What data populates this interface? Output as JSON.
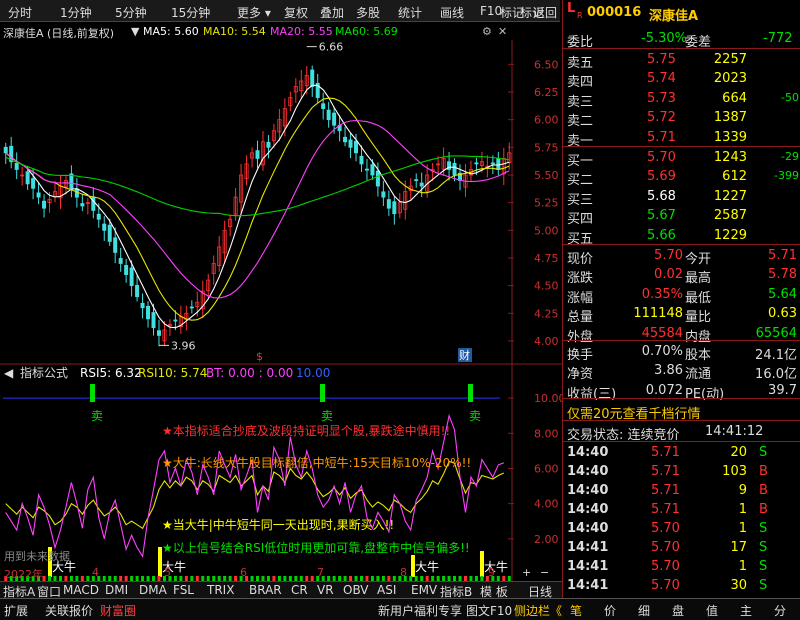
{
  "toolbar": {
    "items": [
      "分时",
      "1分钟",
      "5分钟",
      "15分钟",
      "更多",
      "复权",
      "叠加",
      "多股",
      "统计",
      "画线",
      "F10",
      "标记",
      "+自选",
      "返回"
    ]
  },
  "header": {
    "title": "深康佳A (日线,前复权)",
    "ma5": "MA5: 5.60",
    "ma10": "MA10: 5.54",
    "ma20": "MA20: 5.55",
    "ma60": "MA60: 5.69"
  },
  "price_axis": [
    "6.50",
    "6.25",
    "6.00",
    "5.75",
    "5.50",
    "5.25",
    "5.00",
    "4.75",
    "4.50",
    "4.25",
    "4.00"
  ],
  "high_label": "6.66",
  "low_label": "3.96",
  "rsi_header": {
    "title": "指标公式",
    "rsi5": "RSI5: 6.32",
    "rsi10": "RSI10: 5.74",
    "bt": "BT: 0.00 : 0.00",
    "lvl": "10.00"
  },
  "rsi_axis": [
    "10.00",
    "8.00",
    "6.00",
    "4.00",
    "2.00"
  ],
  "notes": [
    "★本指标适合抄底及波段持证明显个股,暴跌途中慎用!!",
    "★大牛:长线大牛股目标翻倍,中短牛:15天目标10%-20%!!",
    "★当大牛|中牛短牛同一天出现时,果断买入!!",
    "★以上信号结合RSI低位时用更加可靠,盘整市中信号偏多!!"
  ],
  "signals": {
    "sell": "卖",
    "bull": "大牛",
    "cai": "财",
    "s_mark": "$"
  },
  "watermark": "用到未来数据",
  "date_axis": {
    "year": "2022年",
    "m4": "4",
    "m5": "5",
    "m6": "6",
    "m7": "7",
    "m8": "8",
    "m9": "9"
  },
  "tabs": [
    "指标A",
    "窗口",
    "MACD",
    "DMI",
    "DMA",
    "FSL",
    "TRIX",
    "BRAR",
    "CR",
    "VR",
    "OBV",
    "ASI",
    "EMV",
    "指标B",
    "模 板"
  ],
  "period": "日线",
  "bottom": {
    "expand": "扩展",
    "related": "关联报价",
    "wealth": "财富圈",
    "news": "新用户福利专享",
    "f10": "图文F10",
    "side": "侧边栏《"
  },
  "stock": {
    "prefix": "L",
    "sub": "R",
    "code": "000016",
    "name": "深康佳A"
  },
  "weibi": {
    "label": "委比",
    "value": "-5.30%",
    "label2": "委差",
    "value2": "-772"
  },
  "asks": [
    {
      "label": "卖五",
      "price": "5.75",
      "vol": "2257",
      "chg": ""
    },
    {
      "label": "卖四",
      "price": "5.74",
      "vol": "2023",
      "chg": ""
    },
    {
      "label": "卖三",
      "price": "5.73",
      "vol": "664",
      "chg": "-50"
    },
    {
      "label": "卖二",
      "price": "5.72",
      "vol": "1387",
      "chg": ""
    },
    {
      "label": "卖一",
      "price": "5.71",
      "vol": "1339",
      "chg": ""
    }
  ],
  "bids": [
    {
      "label": "买一",
      "price": "5.70",
      "vol": "1243",
      "chg": "-29"
    },
    {
      "label": "买二",
      "price": "5.69",
      "vol": "612",
      "chg": "-399"
    },
    {
      "label": "买三",
      "price": "5.68",
      "vol": "1227",
      "chg": ""
    },
    {
      "label": "买四",
      "price": "5.67",
      "vol": "2587",
      "chg": ""
    },
    {
      "label": "买五",
      "price": "5.66",
      "vol": "1229",
      "chg": ""
    }
  ],
  "stats": [
    {
      "l1": "现价",
      "v1": "5.70",
      "l2": "今开",
      "v2": "5.71"
    },
    {
      "l1": "涨跌",
      "v1": "0.02",
      "l2": "最高",
      "v2": "5.78"
    },
    {
      "l1": "涨幅",
      "v1": "0.35%",
      "l2": "最低",
      "v2": "5.64"
    },
    {
      "l1": "总量",
      "v1": "111148",
      "l2": "量比",
      "v2": "0.63"
    },
    {
      "l1": "外盘",
      "v1": "45584",
      "l2": "内盘",
      "v2": "65564"
    }
  ],
  "stats2": [
    {
      "l1": "换手",
      "v1": "0.70%",
      "l2": "股本",
      "v2": "24.1亿"
    },
    {
      "l1": "净资",
      "v1": "3.86",
      "l2": "流通",
      "v2": "16.0亿"
    },
    {
      "l1": "收益(三)",
      "v1": "0.072",
      "l2": "PE(动)",
      "v2": "39.7"
    }
  ],
  "promo": "仅需20元查看千档行情",
  "trade_state": {
    "label": "交易状态: 连续竞价",
    "time": "14:41:12"
  },
  "ticks": [
    {
      "t": "14:40",
      "p": "5.71",
      "v": "20",
      "d": "S"
    },
    {
      "t": "14:40",
      "p": "5.71",
      "v": "103",
      "d": "B"
    },
    {
      "t": "14:40",
      "p": "5.71",
      "v": "9",
      "d": "B"
    },
    {
      "t": "14:40",
      "p": "5.71",
      "v": "1",
      "d": "B"
    },
    {
      "t": "14:40",
      "p": "5.70",
      "v": "1",
      "d": "S"
    },
    {
      "t": "14:41",
      "p": "5.70",
      "v": "17",
      "d": "S"
    },
    {
      "t": "14:41",
      "p": "5.70",
      "v": "1",
      "d": "S"
    },
    {
      "t": "14:41",
      "p": "5.70",
      "v": "30",
      "d": "S"
    }
  ],
  "right_tabs": [
    "笔",
    "价",
    "细",
    "盘",
    "值",
    "主",
    "分"
  ],
  "chart_data": {
    "type": "candlestick",
    "ylim": [
      3.9,
      6.72
    ],
    "closes": [
      5.7,
      5.62,
      5.55,
      5.5,
      5.42,
      5.38,
      5.3,
      5.2,
      5.28,
      5.35,
      5.4,
      5.45,
      5.38,
      5.3,
      5.22,
      5.25,
      5.18,
      5.1,
      5.0,
      4.9,
      4.8,
      4.7,
      4.6,
      4.5,
      4.4,
      4.3,
      4.2,
      4.12,
      4.05,
      4.1,
      4.15,
      4.18,
      4.22,
      4.25,
      4.3,
      4.35,
      4.45,
      4.55,
      4.7,
      4.85,
      5.0,
      5.1,
      5.3,
      5.5,
      5.6,
      5.7,
      5.65,
      5.8,
      5.75,
      5.9,
      6.0,
      6.1,
      6.2,
      6.3,
      6.35,
      6.4,
      6.3,
      6.2,
      6.1,
      6.0,
      5.95,
      5.9,
      5.8,
      5.75,
      5.7,
      5.6,
      5.55,
      5.5,
      5.4,
      5.3,
      5.2,
      5.15,
      5.25,
      5.35,
      5.4,
      5.45,
      5.4,
      5.5,
      5.55,
      5.6,
      5.65,
      5.55,
      5.5,
      5.45,
      5.5,
      5.55,
      5.6,
      5.62,
      5.58,
      5.6,
      5.55,
      5.65,
      5.7
    ],
    "rsi5": [
      3.5,
      3.0,
      2.5,
      4.0,
      3.2,
      2.2,
      4.5,
      3.8,
      2.8,
      1.5,
      2.5,
      3.8,
      5.2,
      4.0,
      2.6,
      4.8,
      5.5,
      3.2,
      2.0,
      3.5,
      4.2,
      2.8,
      1.4,
      2.2,
      1.5,
      1.0,
      3.2,
      4.8,
      6.5,
      7.0,
      5.2,
      6.0,
      5.0,
      6.5,
      5.8,
      4.5,
      6.2,
      5.5,
      4.5,
      7.0,
      6.2,
      5.5,
      6.8,
      4.8,
      5.6,
      6.5,
      3.5,
      5.0,
      4.2,
      7.2,
      6.5,
      5.0,
      7.8,
      6.2,
      5.5,
      7.0,
      6.0,
      4.5,
      3.8,
      4.2,
      5.0,
      4.0,
      5.2,
      3.5,
      4.5,
      5.0,
      3.2,
      2.6,
      3.5,
      3.0,
      2.4,
      4.5,
      4.0,
      3.0,
      2.5,
      4.2,
      4.8,
      5.5,
      7.0,
      6.0,
      7.5,
      9.0,
      8.2,
      5.5,
      3.5,
      5.5,
      5.0,
      6.5,
      6.0,
      5.5,
      6.2,
      6.32
    ],
    "rsi10": [
      4.0,
      3.7,
      3.4,
      3.8,
      3.5,
      3.2,
      3.8,
      3.6,
      3.3,
      2.8,
      3.0,
      3.4,
      4.0,
      3.8,
      3.4,
      3.9,
      4.2,
      3.7,
      3.3,
      3.5,
      3.8,
      3.4,
      2.8,
      3.0,
      2.8,
      2.6,
      3.2,
      3.8,
      4.8,
      5.3,
      4.9,
      5.3,
      5.0,
      5.5,
      5.3,
      4.8,
      5.3,
      5.1,
      4.7,
      5.6,
      5.4,
      5.2,
      5.6,
      5.0,
      5.3,
      5.6,
      4.5,
      5.0,
      4.7,
      5.8,
      5.6,
      5.2,
      6.0,
      5.6,
      5.4,
      5.8,
      5.4,
      4.8,
      4.4,
      4.6,
      4.9,
      4.5,
      4.9,
      4.3,
      4.6,
      4.8,
      4.2,
      3.8,
      4.1,
      3.9,
      3.6,
      4.2,
      4.0,
      3.7,
      3.5,
      4.0,
      4.3,
      4.7,
      5.3,
      5.1,
      5.7,
      6.4,
      6.3,
      5.4,
      4.6,
      5.2,
      5.1,
      5.6,
      5.5,
      5.4,
      5.6,
      5.74
    ]
  }
}
